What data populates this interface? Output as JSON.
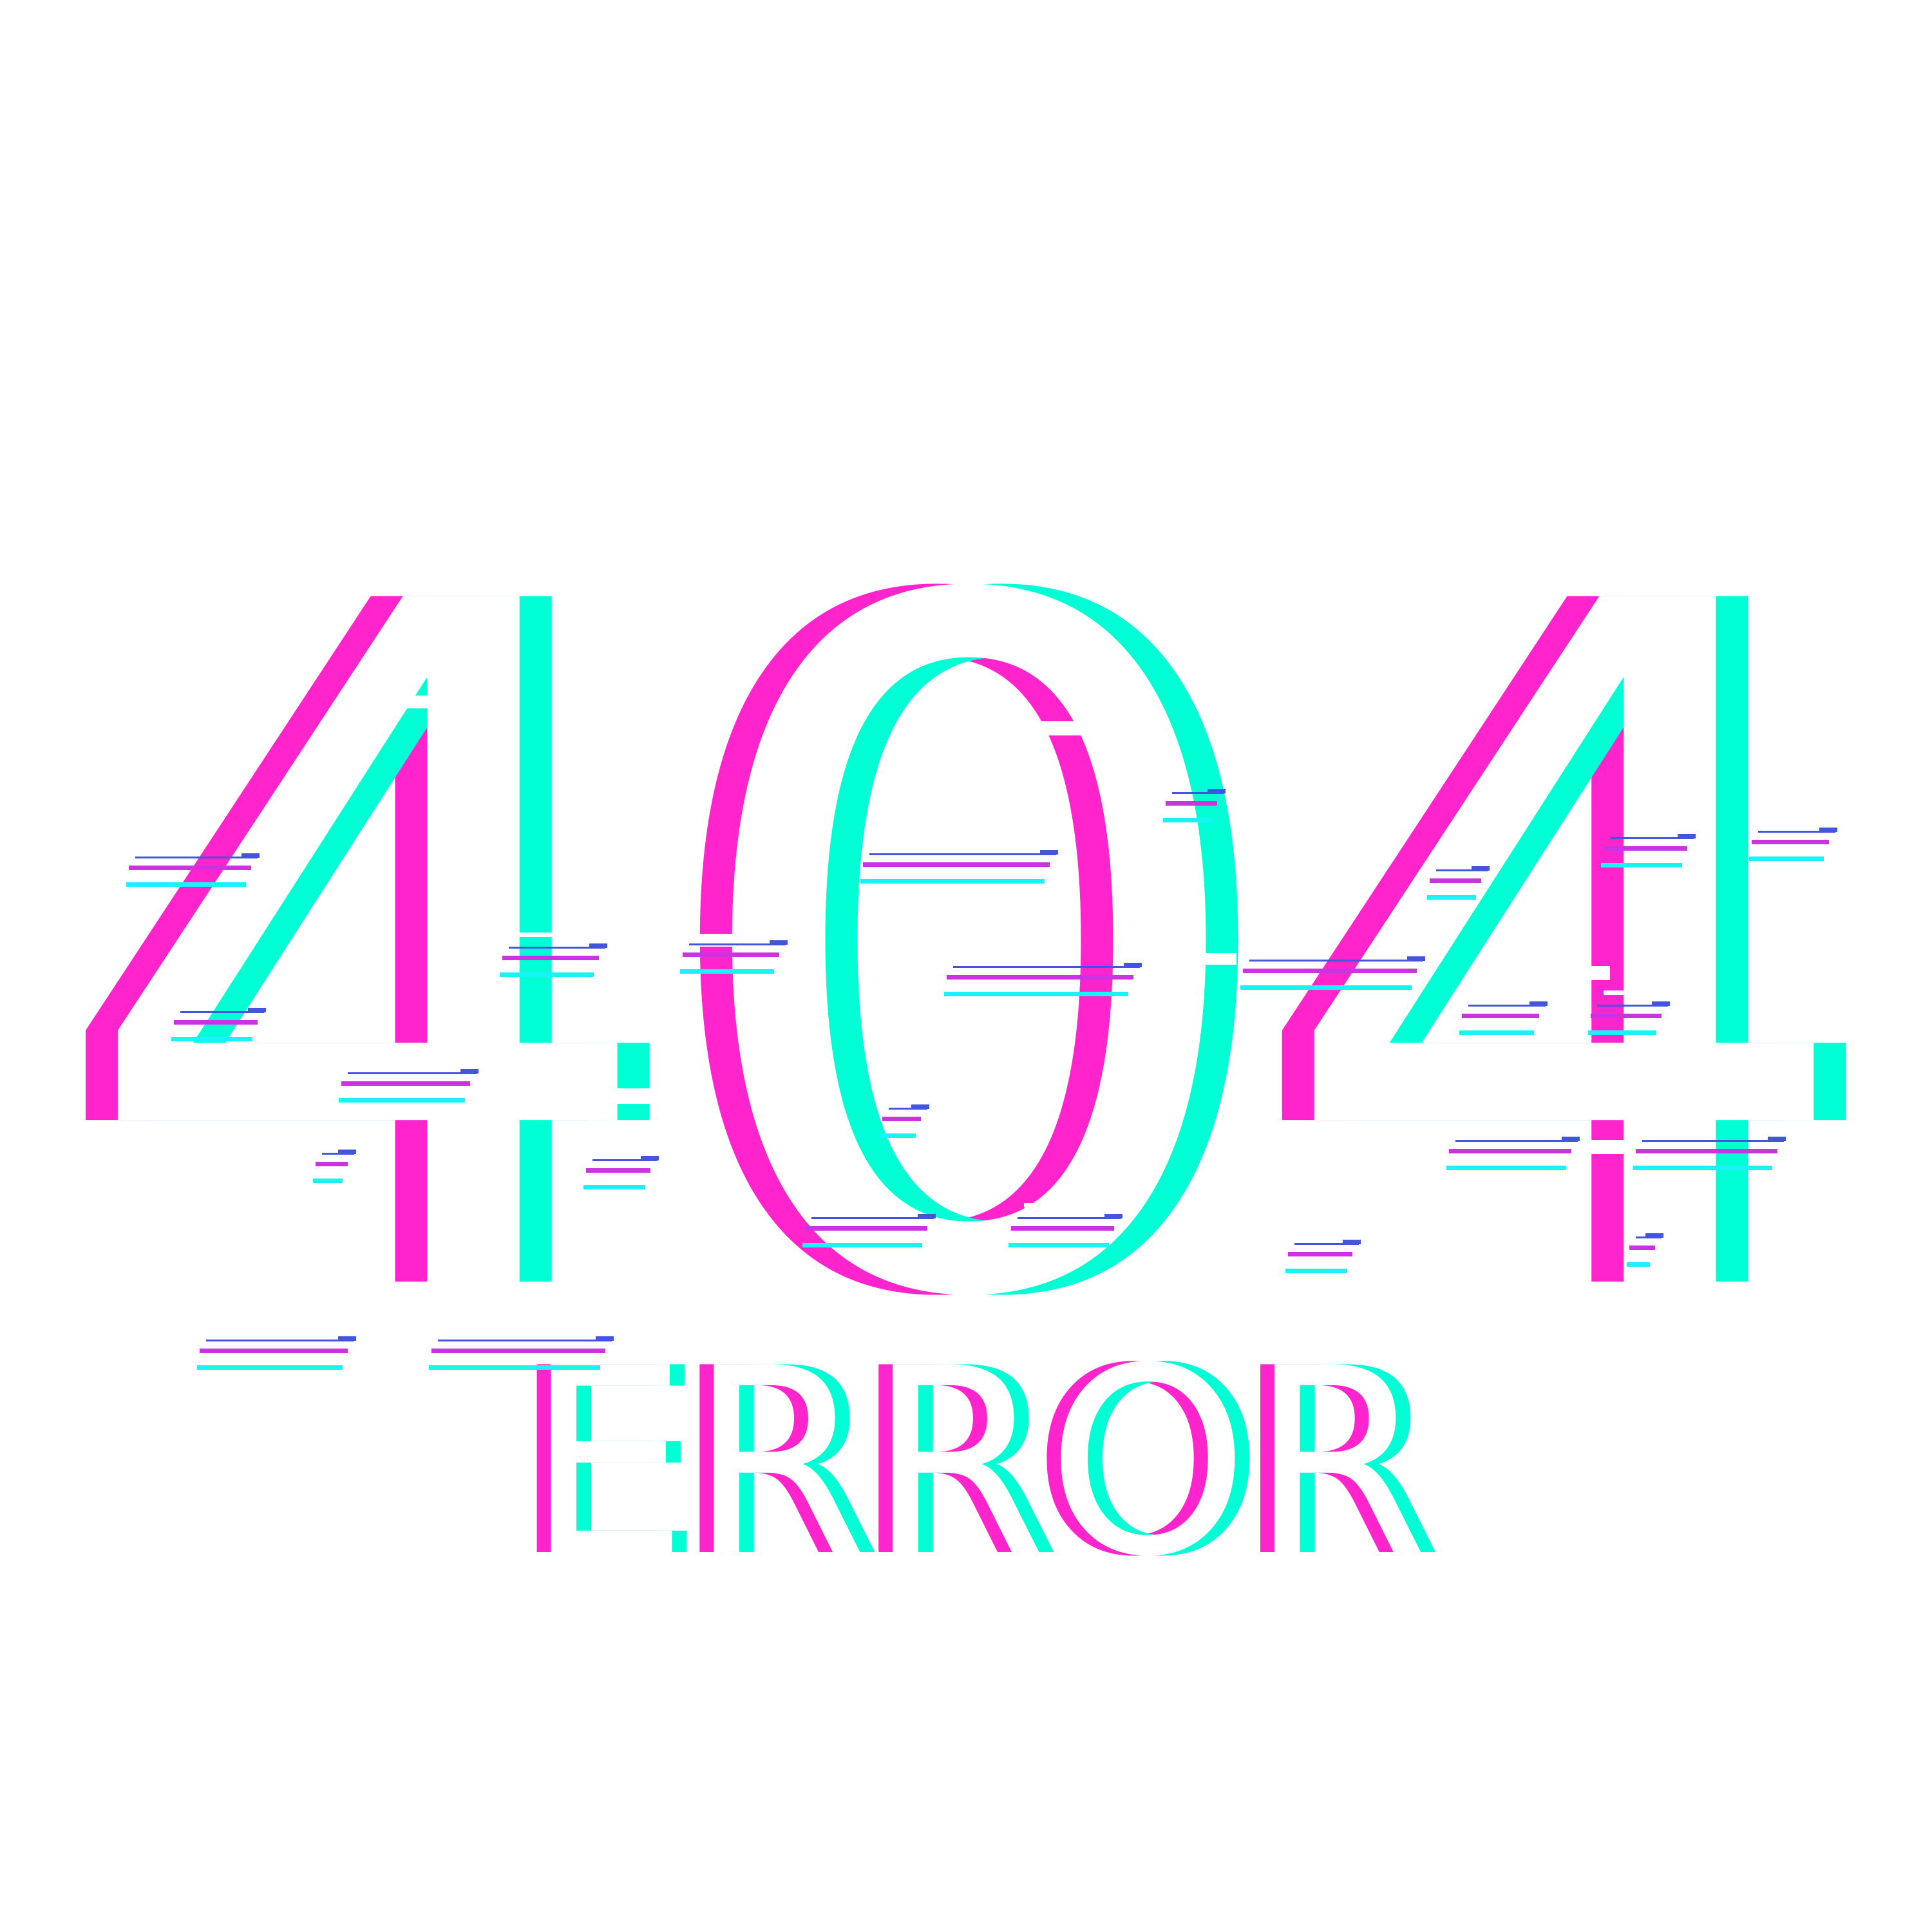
{
  "code": "404",
  "label": "ERROR",
  "colors": {
    "background": "#ffffff",
    "magenta": "#ff24cc",
    "cyan": "#00ffd5",
    "cyan_line": "#19f2f7",
    "purple_line": "#cc33e0",
    "blue_dash": "#4455dd",
    "face": "#ffffff"
  }
}
